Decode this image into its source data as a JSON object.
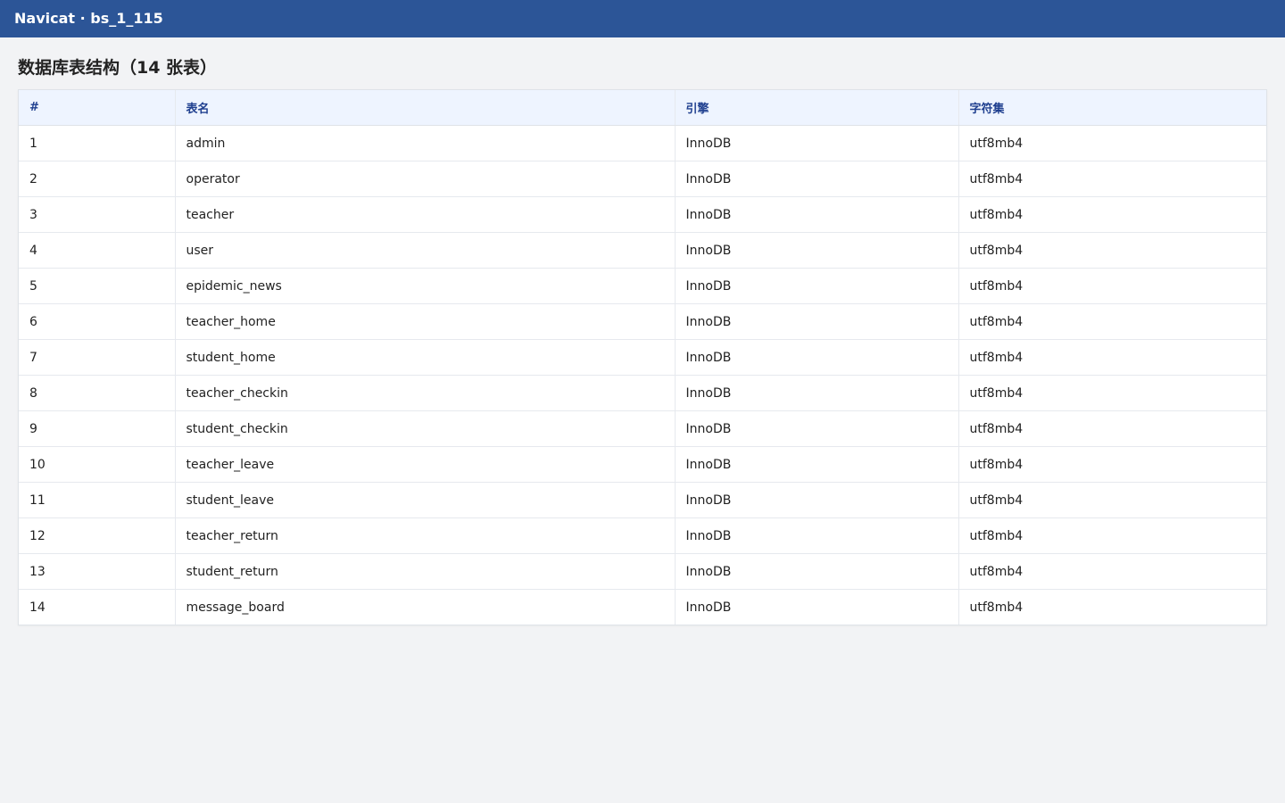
{
  "window": {
    "title": "Navicat · bs_1_115"
  },
  "page": {
    "title": "数据库表结构（14 张表）"
  },
  "table": {
    "headers": {
      "num": "#",
      "name": "表名",
      "engine": "引擎",
      "charset": "字符集"
    },
    "rows": [
      {
        "num": "1",
        "name": "admin",
        "engine": "InnoDB",
        "charset": "utf8mb4"
      },
      {
        "num": "2",
        "name": "operator",
        "engine": "InnoDB",
        "charset": "utf8mb4"
      },
      {
        "num": "3",
        "name": "teacher",
        "engine": "InnoDB",
        "charset": "utf8mb4"
      },
      {
        "num": "4",
        "name": "user",
        "engine": "InnoDB",
        "charset": "utf8mb4"
      },
      {
        "num": "5",
        "name": "epidemic_news",
        "engine": "InnoDB",
        "charset": "utf8mb4"
      },
      {
        "num": "6",
        "name": "teacher_home",
        "engine": "InnoDB",
        "charset": "utf8mb4"
      },
      {
        "num": "7",
        "name": "student_home",
        "engine": "InnoDB",
        "charset": "utf8mb4"
      },
      {
        "num": "8",
        "name": "teacher_checkin",
        "engine": "InnoDB",
        "charset": "utf8mb4"
      },
      {
        "num": "9",
        "name": "student_checkin",
        "engine": "InnoDB",
        "charset": "utf8mb4"
      },
      {
        "num": "10",
        "name": "teacher_leave",
        "engine": "InnoDB",
        "charset": "utf8mb4"
      },
      {
        "num": "11",
        "name": "student_leave",
        "engine": "InnoDB",
        "charset": "utf8mb4"
      },
      {
        "num": "12",
        "name": "teacher_return",
        "engine": "InnoDB",
        "charset": "utf8mb4"
      },
      {
        "num": "13",
        "name": "student_return",
        "engine": "InnoDB",
        "charset": "utf8mb4"
      },
      {
        "num": "14",
        "name": "message_board",
        "engine": "InnoDB",
        "charset": "utf8mb4"
      }
    ]
  },
  "colors": {
    "titlebar": "#2c5597",
    "header_bg": "#eef4ff",
    "header_text": "#1f3f8f",
    "page_bg": "#f2f3f5"
  }
}
